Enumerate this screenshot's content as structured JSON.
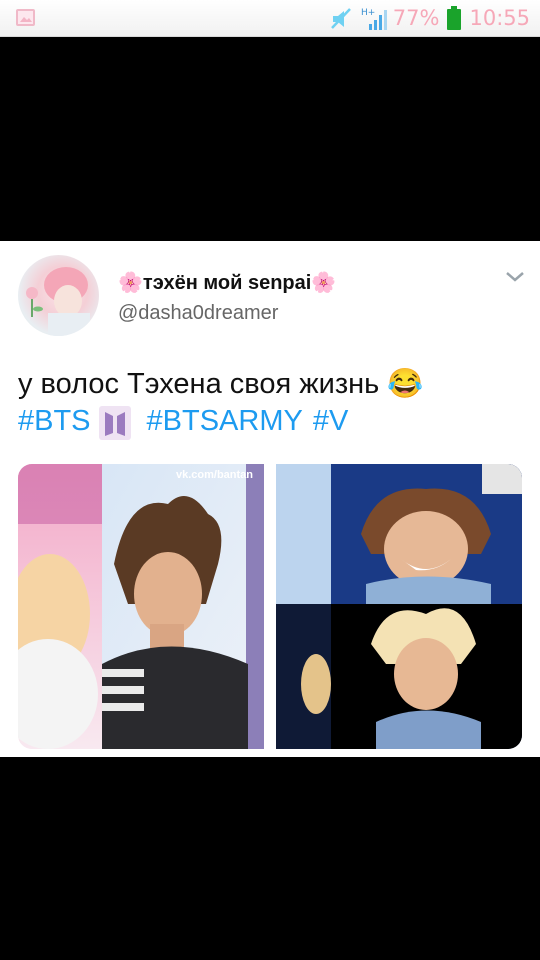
{
  "status_bar": {
    "network": "H+",
    "battery_percent": "77%",
    "time": "10:55",
    "icons": [
      "gallery-icon",
      "mute-icon",
      "signal-icon",
      "battery-icon"
    ],
    "accent_color": "#f6a8b8",
    "battery_color": "#1aa32b"
  },
  "tweet": {
    "display_name": "🌸тэхён мой senpai🌸",
    "handle": "@dasha0dreamer",
    "text": "у волос Тэхена своя жизнь 😂",
    "hashtags": [
      "#BTS",
      "#BTSARMY",
      "#V"
    ],
    "media": {
      "watermark": "vk.com/bantan",
      "count": 2
    },
    "hashtag_color": "#1d9bf0"
  }
}
